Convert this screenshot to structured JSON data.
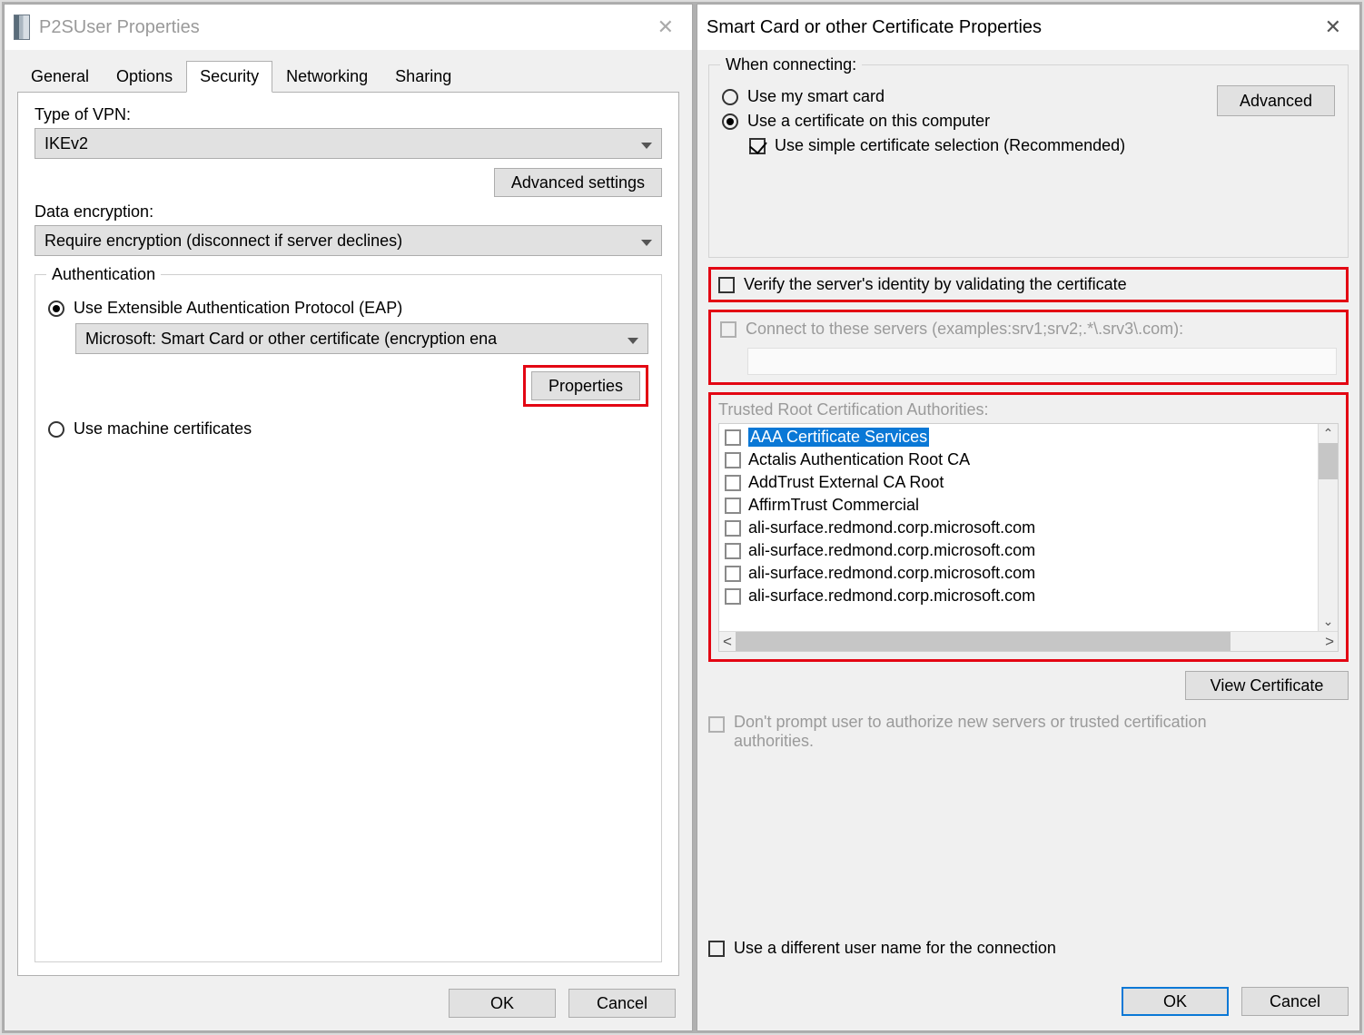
{
  "left": {
    "title": "P2SUser Properties",
    "tabs": [
      "General",
      "Options",
      "Security",
      "Networking",
      "Sharing"
    ],
    "active_tab_index": 2,
    "security": {
      "type_label": "Type of VPN:",
      "type_value": "IKEv2",
      "adv_settings": "Advanced settings",
      "enc_label": "Data encryption:",
      "enc_value": "Require encryption (disconnect if server declines)",
      "auth_title": "Authentication",
      "eap_label": "Use Extensible Authentication Protocol (EAP)",
      "eap_combo": "Microsoft: Smart Card or other certificate (encryption ena",
      "properties_btn": "Properties",
      "machine_certs": "Use machine certificates"
    },
    "ok": "OK",
    "cancel": "Cancel"
  },
  "right": {
    "title": "Smart Card or other Certificate Properties",
    "when_title": "When connecting:",
    "use_smart": "Use my smart card",
    "use_cert": "Use a certificate on this computer",
    "simple": "Use simple certificate selection (Recommended)",
    "advanced_btn": "Advanced",
    "verify": "Verify the server's identity by validating the certificate",
    "connect_servers": "Connect to these servers (examples:srv1;srv2;.*\\.srv3\\.com):",
    "trusted_title": "Trusted Root Certification Authorities:",
    "cas": [
      "AAA Certificate Services",
      "Actalis Authentication Root CA",
      "AddTrust External CA Root",
      "AffirmTrust Commercial",
      "ali-surface.redmond.corp.microsoft.com",
      "ali-surface.redmond.corp.microsoft.com",
      "ali-surface.redmond.corp.microsoft.com",
      "ali-surface.redmond.corp.microsoft.com"
    ],
    "view_cert": "View Certificate",
    "dont_prompt": "Don't prompt user to authorize new servers or trusted certification authorities.",
    "diff_user": "Use a different user name for the connection",
    "ok": "OK",
    "cancel": "Cancel"
  }
}
